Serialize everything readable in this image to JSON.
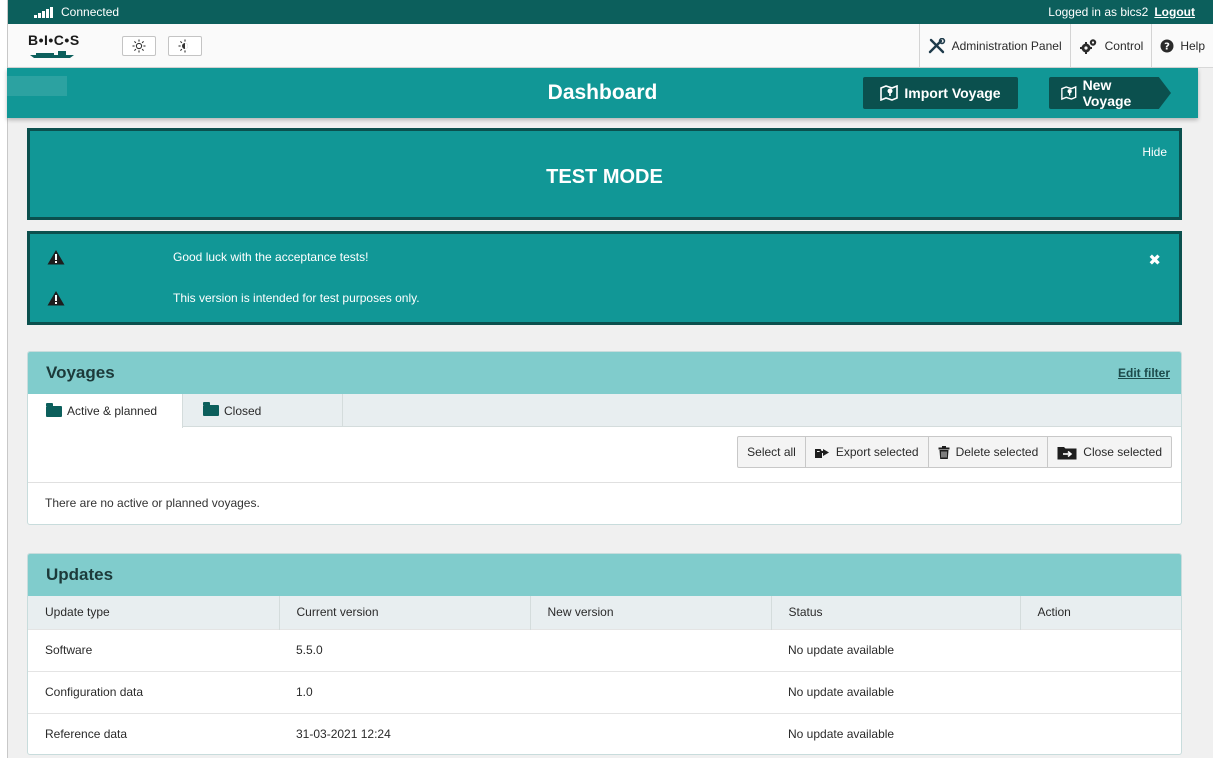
{
  "status_bar": {
    "connection": "Connected",
    "logged_in": "Logged in as bics2",
    "logout": "Logout"
  },
  "toolbar": {
    "logo": "B•I•C•S",
    "brightness_up_icon": "sun-icon",
    "brightness_down_icon": "half-sun-icon",
    "nav": [
      {
        "label": "Administration Panel",
        "icon": "tools-icon"
      },
      {
        "label": "Control",
        "icon": "gears-icon"
      },
      {
        "label": "Help",
        "icon": "question-circle-icon"
      }
    ]
  },
  "header": {
    "title": "Dashboard",
    "import_voyage": "Import Voyage",
    "new_voyage": "New Voyage",
    "bg_color": "#119796",
    "button_color": "#0b504e"
  },
  "test_mode": {
    "title": "TEST MODE",
    "hide": "Hide"
  },
  "messages": [
    {
      "text": "Good luck with the acceptance tests!",
      "icon": "warning-icon"
    },
    {
      "text": "This version is intended for test purposes only.",
      "icon": "warning-icon"
    }
  ],
  "voyages": {
    "title": "Voyages",
    "edit_filter": "Edit filter",
    "tabs": [
      {
        "label": "Active & planned",
        "active": true
      },
      {
        "label": "Closed",
        "active": false
      }
    ],
    "actions": {
      "select_all": "Select all",
      "export_selected": "Export selected",
      "delete_selected": "Delete selected",
      "close_selected": "Close selected"
    },
    "empty_message": "There are no active or planned voyages."
  },
  "updates": {
    "title": "Updates",
    "columns": [
      "Update type",
      "Current version",
      "New version",
      "Status",
      "Action"
    ],
    "rows": [
      [
        "Software",
        "5.5.0",
        "",
        "No update available",
        ""
      ],
      [
        "Configuration data",
        "1.0",
        "",
        "No update available",
        ""
      ],
      [
        "Reference data",
        "31-03-2021 12:24",
        "",
        "No update available",
        ""
      ]
    ]
  }
}
